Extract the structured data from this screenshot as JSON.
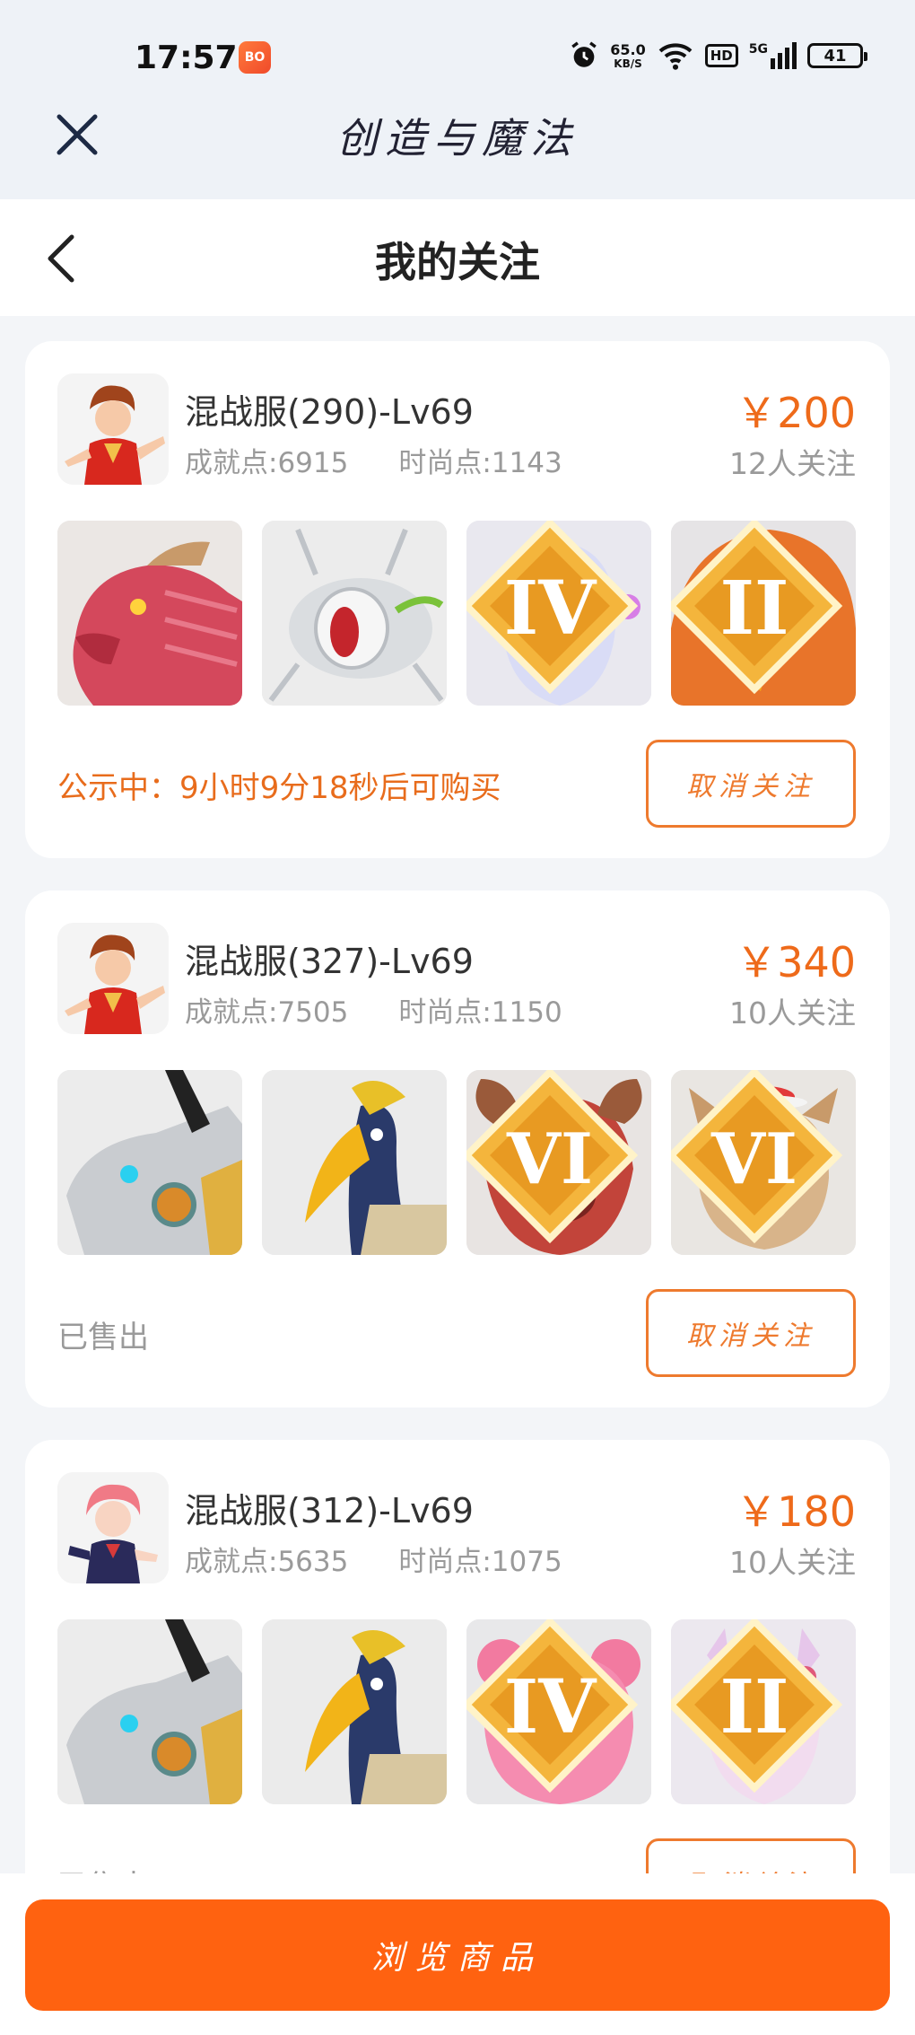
{
  "status_bar": {
    "time": "17:57",
    "app_badge": "BO",
    "net_speed_value": "65.0",
    "net_speed_unit": "KB/S",
    "hd": "HD",
    "network": "5G",
    "battery": "41"
  },
  "app": {
    "title": "创造与魔法"
  },
  "page": {
    "title": "我的关注"
  },
  "listings": [
    {
      "server": "混战服(290)-Lv69",
      "achievement": "成就点:6915",
      "fashion": "时尚点:1143",
      "price": "￥200",
      "follows": "12人关注",
      "status": "公示中：9小时9分18秒后可购买",
      "unfollow_label": "取消关注",
      "pets": [
        {
          "icon": "red-dragon-icon",
          "rank": ""
        },
        {
          "icon": "silver-mecha-bug-icon",
          "rank": ""
        },
        {
          "icon": "moon-spirit-icon",
          "rank": "IV"
        },
        {
          "icon": "fire-griffin-icon",
          "rank": "II"
        }
      ]
    },
    {
      "server": "混战服(327)-Lv69",
      "achievement": "成就点:7505",
      "fashion": "时尚点:1150",
      "price": "￥340",
      "follows": "10人关注",
      "status": "已售出",
      "unfollow_label": "取消关注",
      "pets": [
        {
          "icon": "mecha-dragon-icon",
          "rank": ""
        },
        {
          "icon": "hornbill-icon",
          "rank": ""
        },
        {
          "icon": "ram-demon-icon",
          "rank": "VI"
        },
        {
          "icon": "chipmunk-icon",
          "rank": "VI"
        }
      ]
    },
    {
      "server": "混战服(312)-Lv69",
      "achievement": "成就点:5635",
      "fashion": "时尚点:1075",
      "price": "￥180",
      "follows": "10人关注",
      "status": "已售出",
      "unfollow_label": "取消关注",
      "pets": [
        {
          "icon": "mecha-dragon-icon",
          "rank": ""
        },
        {
          "icon": "hornbill-icon",
          "rank": ""
        },
        {
          "icon": "pink-bear-icon",
          "rank": "IV"
        },
        {
          "icon": "fox-spirit-icon",
          "rank": "II"
        }
      ]
    }
  ],
  "footer": {
    "browse_label": "浏览商品"
  },
  "colors": {
    "accent": "#ff6210",
    "price": "#ee6a1a",
    "muted": "#9a9a9a"
  }
}
